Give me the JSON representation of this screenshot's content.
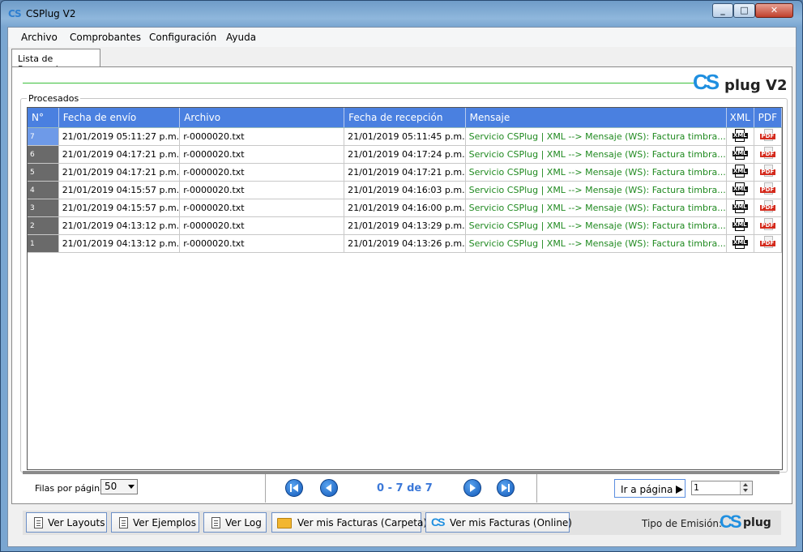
{
  "window": {
    "title": "CSPlug V2",
    "app_icon": "CS",
    "controls": {
      "minimize": "_",
      "maximize": "□",
      "close": "✕"
    }
  },
  "menu": [
    "Archivo",
    "Comprobantes",
    "Configuración",
    "Ayuda"
  ],
  "tabs": [
    {
      "label": "Lista de Procesados",
      "selected": true
    }
  ],
  "brand": {
    "cs": "CS",
    "rest": "plug V2"
  },
  "group_label": "Procesados",
  "table": {
    "columns": [
      "N°",
      "Fecha de envío",
      "Archivo",
      "Fecha de recepción",
      "Mensaje",
      "XML",
      "PDF"
    ],
    "rows": [
      {
        "n": "7",
        "sent": "21/01/2019 05:11:27 p.m.",
        "file": "r-0000020.txt",
        "received": "21/01/2019 05:11:45 p.m.",
        "message": "Servicio CSPlug |  XML --> Mensaje (WS): Factura timbra...",
        "xml": "XML",
        "pdf": "PDF"
      },
      {
        "n": "6",
        "sent": "21/01/2019 04:17:21 p.m.",
        "file": "r-0000020.txt",
        "received": "21/01/2019 04:17:24 p.m.",
        "message": "Servicio CSPlug |  XML --> Mensaje (WS): Factura timbra...",
        "xml": "XML",
        "pdf": "PDF"
      },
      {
        "n": "5",
        "sent": "21/01/2019 04:17:21 p.m.",
        "file": "r-0000020.txt",
        "received": "21/01/2019 04:17:21 p.m.",
        "message": "Servicio CSPlug |  XML --> Mensaje (WS): Factura timbra...",
        "xml": "XML",
        "pdf": "PDF"
      },
      {
        "n": "4",
        "sent": "21/01/2019 04:15:57 p.m.",
        "file": "r-0000020.txt",
        "received": "21/01/2019 04:16:03 p.m.",
        "message": "Servicio CSPlug |  XML --> Mensaje (WS): Factura timbra...",
        "xml": "XML",
        "pdf": "PDF"
      },
      {
        "n": "3",
        "sent": "21/01/2019 04:15:57 p.m.",
        "file": "r-0000020.txt",
        "received": "21/01/2019 04:16:00 p.m.",
        "message": "Servicio CSPlug |  XML --> Mensaje (WS): Factura timbra...",
        "xml": "XML",
        "pdf": "PDF"
      },
      {
        "n": "2",
        "sent": "21/01/2019 04:13:12 p.m.",
        "file": "r-0000020.txt",
        "received": "21/01/2019 04:13:29 p.m.",
        "message": "Servicio CSPlug |  XML --> Mensaje (WS): Factura timbra...",
        "xml": "XML",
        "pdf": "PDF"
      },
      {
        "n": "1",
        "sent": "21/01/2019 04:13:12 p.m.",
        "file": "r-0000020.txt",
        "received": "21/01/2019 04:13:26 p.m.",
        "message": "Servicio CSPlug |  XML --> Mensaje (WS): Factura timbra...",
        "xml": "XML",
        "pdf": "PDF"
      }
    ]
  },
  "pager": {
    "rows_label": "Filas por página",
    "rows_per_page": "50",
    "page_info": "0 - 7 de 7",
    "goto_label": "Ir a página",
    "page_value": "1"
  },
  "buttons": [
    {
      "label": "Ver Layouts",
      "icon": "document-icon"
    },
    {
      "label": "Ver Ejemplos",
      "icon": "document-icon"
    },
    {
      "label": "Ver Log",
      "icon": "document-icon"
    },
    {
      "label": "Ver mis Facturas (Carpeta)",
      "icon": "folder-icon"
    },
    {
      "label": "Ver mis Facturas (Online)",
      "icon": "csplug-icon"
    }
  ],
  "emission": {
    "label": "Tipo de Emisión:",
    "cs": "CS",
    "rest": "plug"
  },
  "colors": {
    "header_blue": "#4a80e0",
    "message_green": "#208a20",
    "brand_blue": "#1f8fe0",
    "page_info_blue": "#3b78d8",
    "pdf_red": "#d42a1c"
  }
}
